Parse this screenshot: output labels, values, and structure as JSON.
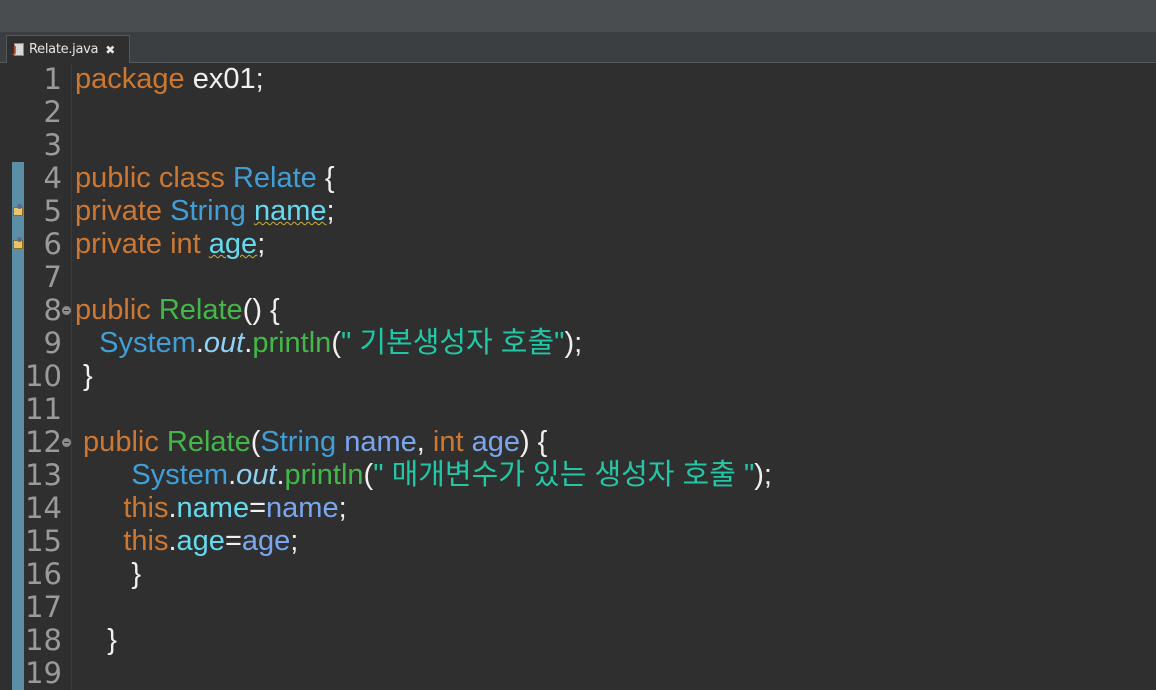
{
  "tab": {
    "filename": "Relate.java",
    "close_glyph": "✖"
  },
  "lines": [
    {
      "n": "1",
      "tokens": [
        {
          "t": "package",
          "c": "kw"
        },
        {
          "t": " ex01;",
          "c": "punc"
        }
      ]
    },
    {
      "n": "2",
      "tokens": []
    },
    {
      "n": "3",
      "tokens": []
    },
    {
      "n": "4",
      "tokens": [
        {
          "t": "public class ",
          "c": "kw"
        },
        {
          "t": "Relate",
          "c": "type"
        },
        {
          "t": " {",
          "c": "punc"
        }
      ]
    },
    {
      "n": "5",
      "tokens": [
        {
          "t": "private ",
          "c": "kw"
        },
        {
          "t": "String",
          "c": "type"
        },
        {
          "t": " ",
          "c": "punc"
        },
        {
          "t": "name",
          "c": "field",
          "w": true
        },
        {
          "t": ";",
          "c": "punc"
        }
      ]
    },
    {
      "n": "6",
      "tokens": [
        {
          "t": "private int ",
          "c": "kw"
        },
        {
          "t": "age",
          "c": "field",
          "w": true
        },
        {
          "t": ";",
          "c": "punc"
        }
      ]
    },
    {
      "n": "7",
      "tokens": []
    },
    {
      "n": "8",
      "tokens": [
        {
          "t": "public ",
          "c": "kw"
        },
        {
          "t": "Relate",
          "c": "method"
        },
        {
          "t": "() {",
          "c": "punc"
        }
      ]
    },
    {
      "n": "9",
      "tokens": [
        {
          "t": "   ",
          "c": "punc"
        },
        {
          "t": "System",
          "c": "type"
        },
        {
          "t": ".",
          "c": "punc"
        },
        {
          "t": "out",
          "c": "static"
        },
        {
          "t": ".",
          "c": "punc"
        },
        {
          "t": "println",
          "c": "method"
        },
        {
          "t": "(",
          "c": "punc"
        },
        {
          "t": "\" 기본생성자 호출\"",
          "c": "str"
        },
        {
          "t": ");",
          "c": "punc"
        }
      ]
    },
    {
      "n": "10",
      "tokens": [
        {
          "t": " }",
          "c": "punc"
        }
      ]
    },
    {
      "n": "11",
      "tokens": []
    },
    {
      "n": "12",
      "tokens": [
        {
          "t": " public ",
          "c": "kw"
        },
        {
          "t": "Relate",
          "c": "method"
        },
        {
          "t": "(",
          "c": "punc"
        },
        {
          "t": "String",
          "c": "type"
        },
        {
          "t": " ",
          "c": "punc"
        },
        {
          "t": "name",
          "c": "param"
        },
        {
          "t": ", ",
          "c": "punc"
        },
        {
          "t": "int ",
          "c": "kw"
        },
        {
          "t": "age",
          "c": "param"
        },
        {
          "t": ") {",
          "c": "punc"
        }
      ]
    },
    {
      "n": "13",
      "tokens": [
        {
          "t": "       ",
          "c": "punc"
        },
        {
          "t": "System",
          "c": "type"
        },
        {
          "t": ".",
          "c": "punc"
        },
        {
          "t": "out",
          "c": "static"
        },
        {
          "t": ".",
          "c": "punc"
        },
        {
          "t": "println",
          "c": "method"
        },
        {
          "t": "(",
          "c": "punc"
        },
        {
          "t": "\" 매개변수가 있는 생성자 호출 \"",
          "c": "str"
        },
        {
          "t": ");",
          "c": "punc"
        }
      ]
    },
    {
      "n": "14",
      "tokens": [
        {
          "t": "      ",
          "c": "punc"
        },
        {
          "t": "this",
          "c": "kw"
        },
        {
          "t": ".",
          "c": "punc"
        },
        {
          "t": "name",
          "c": "field"
        },
        {
          "t": "=",
          "c": "punc"
        },
        {
          "t": "name",
          "c": "param"
        },
        {
          "t": ";",
          "c": "punc"
        }
      ]
    },
    {
      "n": "15",
      "tokens": [
        {
          "t": "      ",
          "c": "punc"
        },
        {
          "t": "this",
          "c": "kw"
        },
        {
          "t": ".",
          "c": "punc"
        },
        {
          "t": "age",
          "c": "field"
        },
        {
          "t": "=",
          "c": "punc"
        },
        {
          "t": "age",
          "c": "param"
        },
        {
          "t": ";",
          "c": "punc"
        }
      ]
    },
    {
      "n": "16",
      "tokens": [
        {
          "t": "       }",
          "c": "punc"
        }
      ]
    },
    {
      "n": "17",
      "tokens": []
    },
    {
      "n": "18",
      "tokens": [
        {
          "t": "    }",
          "c": "punc"
        }
      ]
    },
    {
      "n": "19",
      "tokens": []
    }
  ],
  "markers": [
    "5",
    "6"
  ],
  "folds": [
    "8",
    "12"
  ],
  "colors": {
    "keyword": "#cc7832",
    "type": "#3f9fd6",
    "method": "#43b849",
    "field": "#66d9ef",
    "string": "#22c7a6",
    "background": "#2f2f2f"
  }
}
